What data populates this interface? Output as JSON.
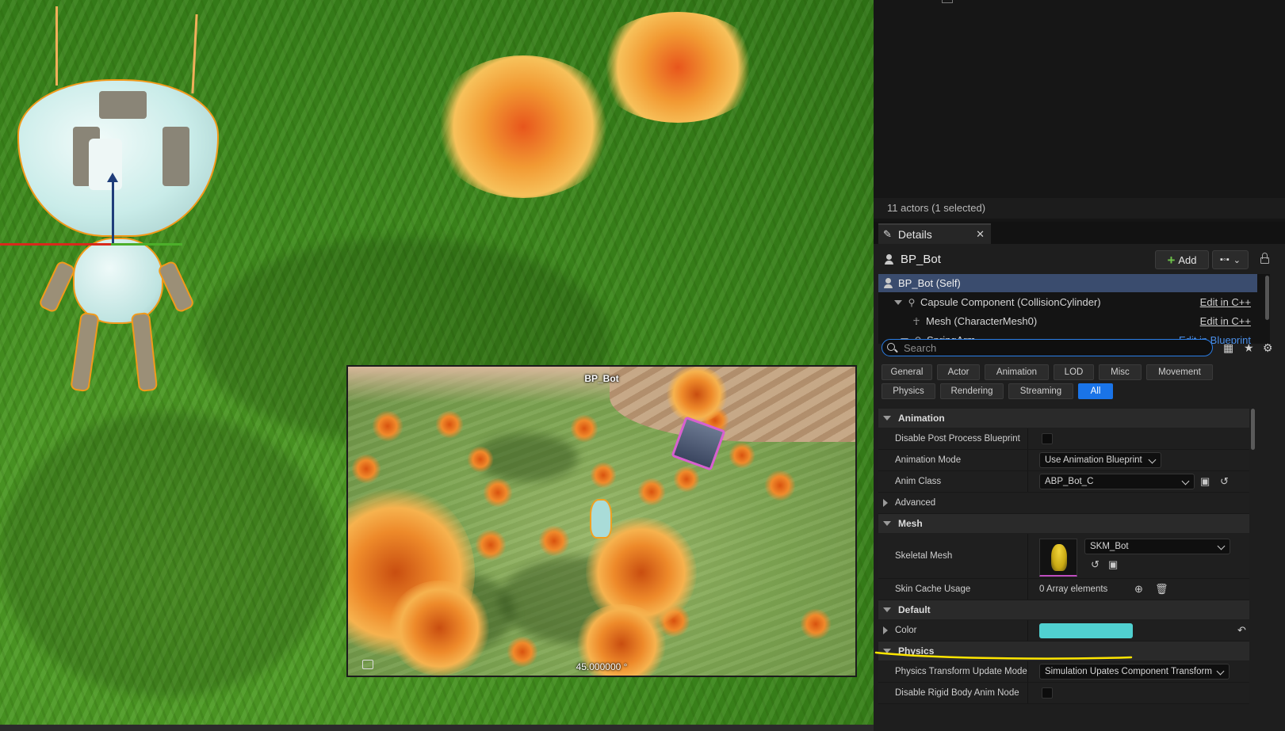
{
  "viewport": {
    "preview": {
      "title": "BP_Bot",
      "footer": "45.000000 °"
    }
  },
  "outliner": {
    "actor_count": "11 actors (1 selected)"
  },
  "details": {
    "tab_label": "Details",
    "actor_name": "BP_Bot",
    "add_label": "Add",
    "components": [
      {
        "label": "BP_Bot (Self)",
        "action": ""
      },
      {
        "label": "Capsule Component (CollisionCylinder)",
        "action": "Edit in C++"
      },
      {
        "label": "Mesh (CharacterMesh0)",
        "action": "Edit in C++"
      },
      {
        "label": "SpringArm",
        "action": "Edit in Blueprint"
      }
    ],
    "search": {
      "placeholder": "Search"
    },
    "filters": [
      "General",
      "Actor",
      "Animation",
      "LOD",
      "Misc",
      "Movement",
      "Physics",
      "Rendering",
      "Streaming",
      "All"
    ],
    "active_filter": "All",
    "sections": {
      "animation": {
        "title": "Animation",
        "disable_post_process": {
          "label": "Disable Post Process Blueprint",
          "checked": false
        },
        "animation_mode": {
          "label": "Animation Mode",
          "value": "Use Animation Blueprint"
        },
        "anim_class": {
          "label": "Anim Class",
          "value": "ABP_Bot_C"
        },
        "advanced": "Advanced"
      },
      "mesh": {
        "title": "Mesh",
        "skeletal_mesh": {
          "label": "Skeletal Mesh",
          "value": "SKM_Bot"
        },
        "skin_cache": {
          "label": "Skin Cache Usage",
          "value": "0 Array elements"
        }
      },
      "default": {
        "title": "Default",
        "color": {
          "label": "Color",
          "value": "#50d0d0"
        }
      },
      "physics": {
        "title": "Physics",
        "transform_update": {
          "label": "Physics Transform Update Mode",
          "value": "Simulation Upates Component Transform"
        },
        "disable_rigid": {
          "label": "Disable Rigid Body Anim Node",
          "checked": false
        }
      }
    }
  },
  "colors": {
    "accent": "#1a74e8",
    "selection": "#3a4c6e",
    "annotation": "#ffe600",
    "selection_outline": "#f29a1a"
  }
}
